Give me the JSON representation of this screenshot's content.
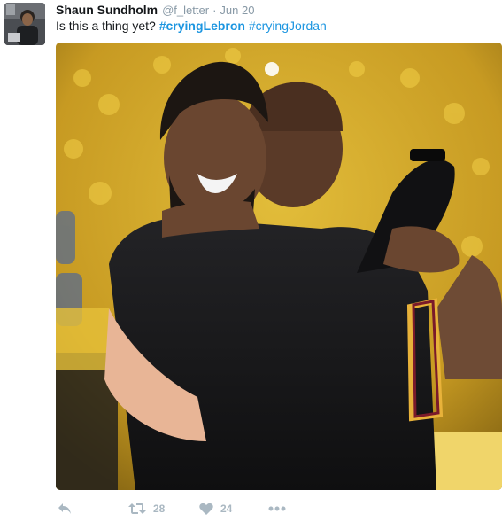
{
  "tweet": {
    "fullname": "Shaun Sundholm",
    "username": "@f_letter",
    "separator": "·",
    "time": "Jun 20",
    "text_plain": "Is this a thing yet? ",
    "hashtag_1": "#cryingLebron",
    "hashtag_2": "#cryingJordan",
    "retweet_count": "28",
    "like_count": "24"
  },
  "icons": {
    "reply": "reply-icon",
    "retweet": "retweet-icon",
    "like": "heart-icon",
    "more": "more-icon"
  },
  "colors": {
    "link": "#1b95e0",
    "muted": "#8899a6",
    "action": "#aab8c2"
  }
}
